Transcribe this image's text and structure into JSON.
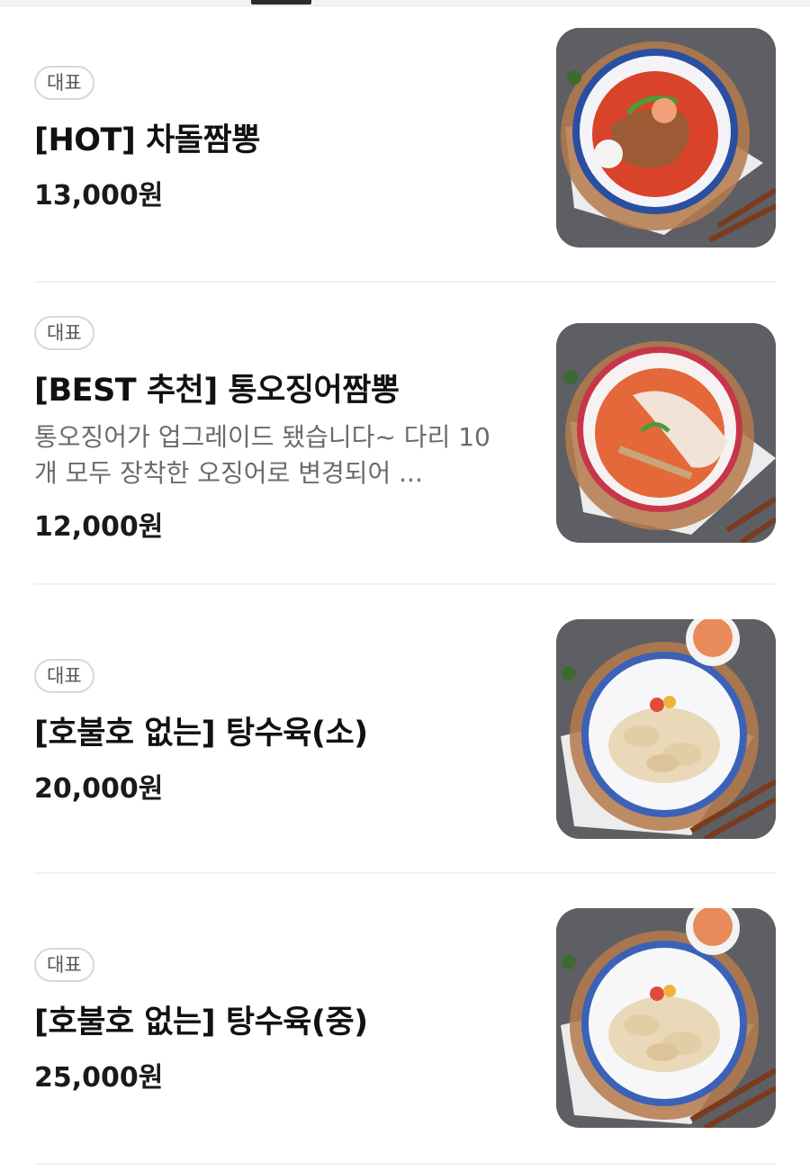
{
  "colors": {
    "divider": "#f1f1f1",
    "badge_border": "#d7d7d7",
    "text_primary": "#111111",
    "text_secondary": "#6b6b6b",
    "photo_background": "#5d5f64"
  },
  "menu": {
    "items": [
      {
        "badge": "대표",
        "name": "[HOT] 차돌짬뽕",
        "description": "",
        "price": "13,000원",
        "photo": "jjamppong-red-photo"
      },
      {
        "badge": "대표",
        "name": "[BEST 추천] 통오징어짬뽕",
        "description": "통오징어가 업그레이드 됐습니다~ 다리 10개 모두 장착한 오징어로 변경되어 ...",
        "price": "12,000원",
        "photo": "squid-jjamppong-photo"
      },
      {
        "badge": "대표",
        "name": "[호불호 없는] 탕수육(소)",
        "description": "",
        "price": "20,000원",
        "photo": "tangsuyuk-photo"
      },
      {
        "badge": "대표",
        "name": "[호불호 없는] 탕수육(중)",
        "description": "",
        "price": "25,000원",
        "photo": "tangsuyuk-photo"
      }
    ]
  }
}
